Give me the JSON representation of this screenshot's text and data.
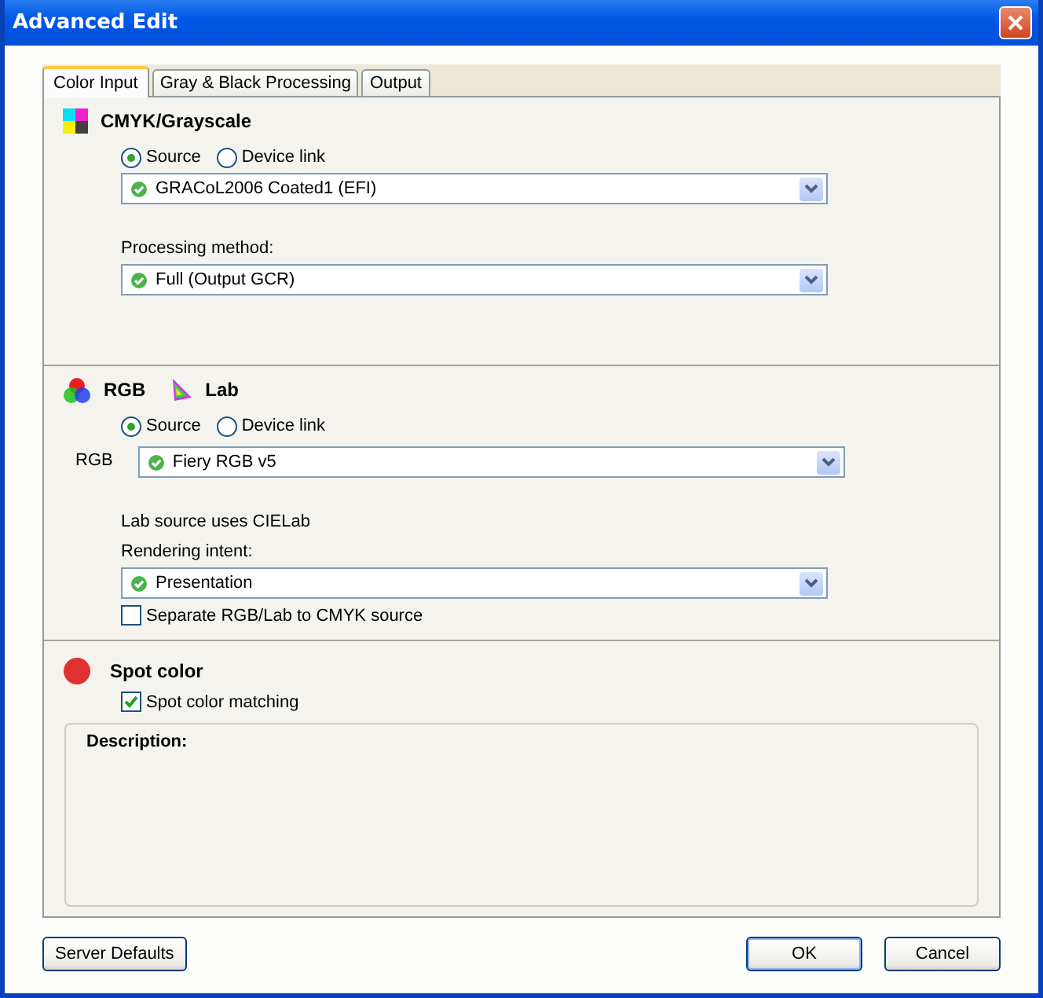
{
  "window": {
    "title": "Advanced Edit"
  },
  "tabs": [
    {
      "label": "Color Input",
      "selected": true
    },
    {
      "label": "Gray & Black Processing",
      "selected": false
    },
    {
      "label": "Output",
      "selected": false
    }
  ],
  "cmyk_grayscale": {
    "heading": "CMYK/Grayscale",
    "source_options": [
      {
        "label": "Source",
        "selected": true
      },
      {
        "label": "Device link",
        "selected": false
      }
    ],
    "profile": {
      "value": "GRACoL2006 Coated1 (EFI)"
    },
    "processing_method": {
      "label": "Processing method:",
      "value": "Full (Output GCR)"
    }
  },
  "rgb_lab": {
    "headings": [
      "RGB",
      "Lab"
    ],
    "source_options": [
      {
        "label": "Source",
        "selected": true
      },
      {
        "label": "Device link",
        "selected": false
      }
    ],
    "rgb_profile": {
      "label": "RGB",
      "value": "Fiery RGB v5"
    },
    "lab_note": "Lab source uses CIELab",
    "rendering_intent": {
      "label": "Rendering intent:",
      "value": "Presentation"
    },
    "separate": {
      "label": "Separate RGB/Lab to CMYK source",
      "checked": false
    }
  },
  "spot_color": {
    "heading": "Spot color",
    "matching": {
      "label": "Spot color matching",
      "checked": true
    }
  },
  "description": {
    "label": "Description:"
  },
  "buttons": [
    {
      "label": "Server Defaults",
      "kind": "secondary"
    },
    {
      "label": "OK",
      "kind": "default"
    },
    {
      "label": "Cancel",
      "kind": "normal"
    }
  ]
}
